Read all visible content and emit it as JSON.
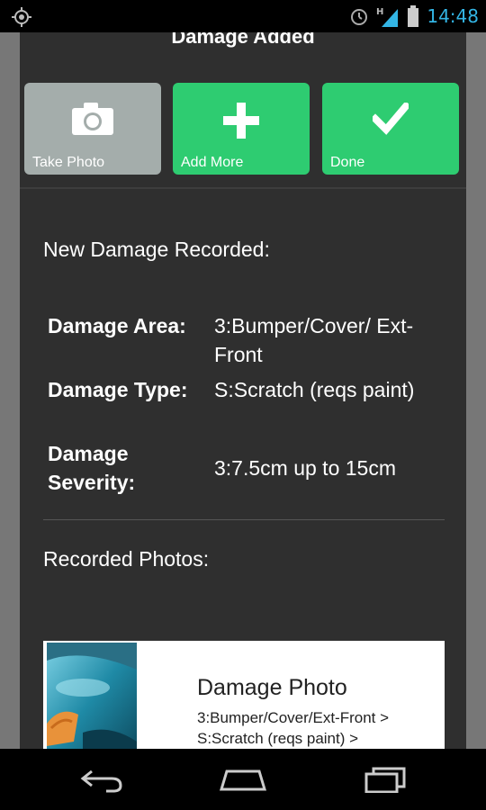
{
  "status_bar": {
    "time": "14:48",
    "icons": [
      "gps-icon",
      "alarm-icon",
      "signal-icon",
      "battery-icon"
    ],
    "network_label": "H"
  },
  "dialog": {
    "title": "Damage Added"
  },
  "actions": {
    "take_photo": "Take Photo",
    "add_more": "Add More",
    "done": "Done"
  },
  "summary": {
    "heading": "New Damage Recorded:",
    "rows": [
      {
        "label": "Damage Area:",
        "value": "3:Bumper/Cover/ Ext-Front"
      },
      {
        "label": "Damage Type:",
        "value": "S:Scratch (reqs paint)"
      },
      {
        "label": "Damage Severity:",
        "value": "3:7.5cm up to 15cm"
      }
    ]
  },
  "photos": {
    "heading": "Recorded Photos:",
    "items": [
      {
        "title": "Damage Photo",
        "description": "3:Bumper/Cover/Ext-Front > S:Scratch (reqs paint) >"
      }
    ]
  },
  "colors": {
    "accent_green": "#2ecc71",
    "photo_button_gray": "#a4adab",
    "status_time_blue": "#33b5e5"
  }
}
